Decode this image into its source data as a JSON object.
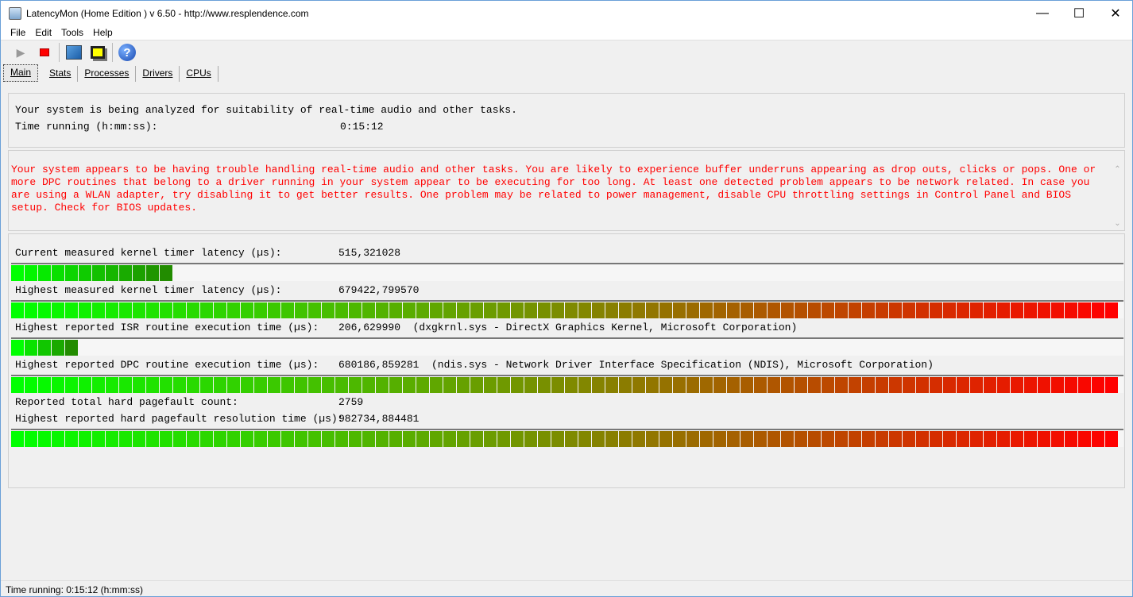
{
  "window": {
    "title": "LatencyMon  (Home Edition )  v 6.50 - http://www.resplendence.com"
  },
  "menu": [
    "File",
    "Edit",
    "Tools",
    "Help"
  ],
  "tabs": [
    "Main",
    "Stats",
    "Processes",
    "Drivers",
    "CPUs"
  ],
  "summary": {
    "line1": "Your system is being analyzed for suitability of real-time audio and other tasks.",
    "time_label": "Time running (h:mm:ss):",
    "time_value": "0:15:12"
  },
  "warning": "Your system appears to be having trouble handling real-time audio and other tasks. You are likely to experience buffer underruns appearing as drop outs, clicks or pops. One or more DPC routines that belong to a driver running in your system appear to be executing for too long. At least one detected problem appears to be network related. In case you are using a WLAN adapter, try disabling it to get better results. One problem may be related to power management, disable CPU throttling settings in Control Panel and BIOS setup. Check for BIOS updates.",
  "warning_color": "#ff0000",
  "metrics": [
    {
      "label": "Current measured kernel timer latency (µs):",
      "value": "515,321028",
      "detail": "",
      "fill": 0.146
    },
    {
      "label": "Highest measured kernel timer latency (µs):",
      "value": "679422,799570",
      "detail": "",
      "fill": 1.0
    },
    {
      "label": "Highest reported ISR routine execution time (µs):",
      "value": "206,629990",
      "detail": "(dxgkrnl.sys - DirectX Graphics Kernel, Microsoft Corporation)",
      "fill": 0.061
    },
    {
      "label": "Highest reported DPC routine execution time (µs):",
      "value": "680186,859281",
      "detail": "(ndis.sys - Network Driver Interface Specification (NDIS), Microsoft Corporation)",
      "fill": 1.0
    },
    {
      "label": "Reported total hard pagefault count:",
      "value": "2759",
      "detail": ""
    },
    {
      "label": "Highest reported hard pagefault resolution time (µs):",
      "value": "982734,884481",
      "detail": "",
      "fill": 1.0
    }
  ],
  "status": "Time running: 0:15:12  (h:mm:ss)"
}
